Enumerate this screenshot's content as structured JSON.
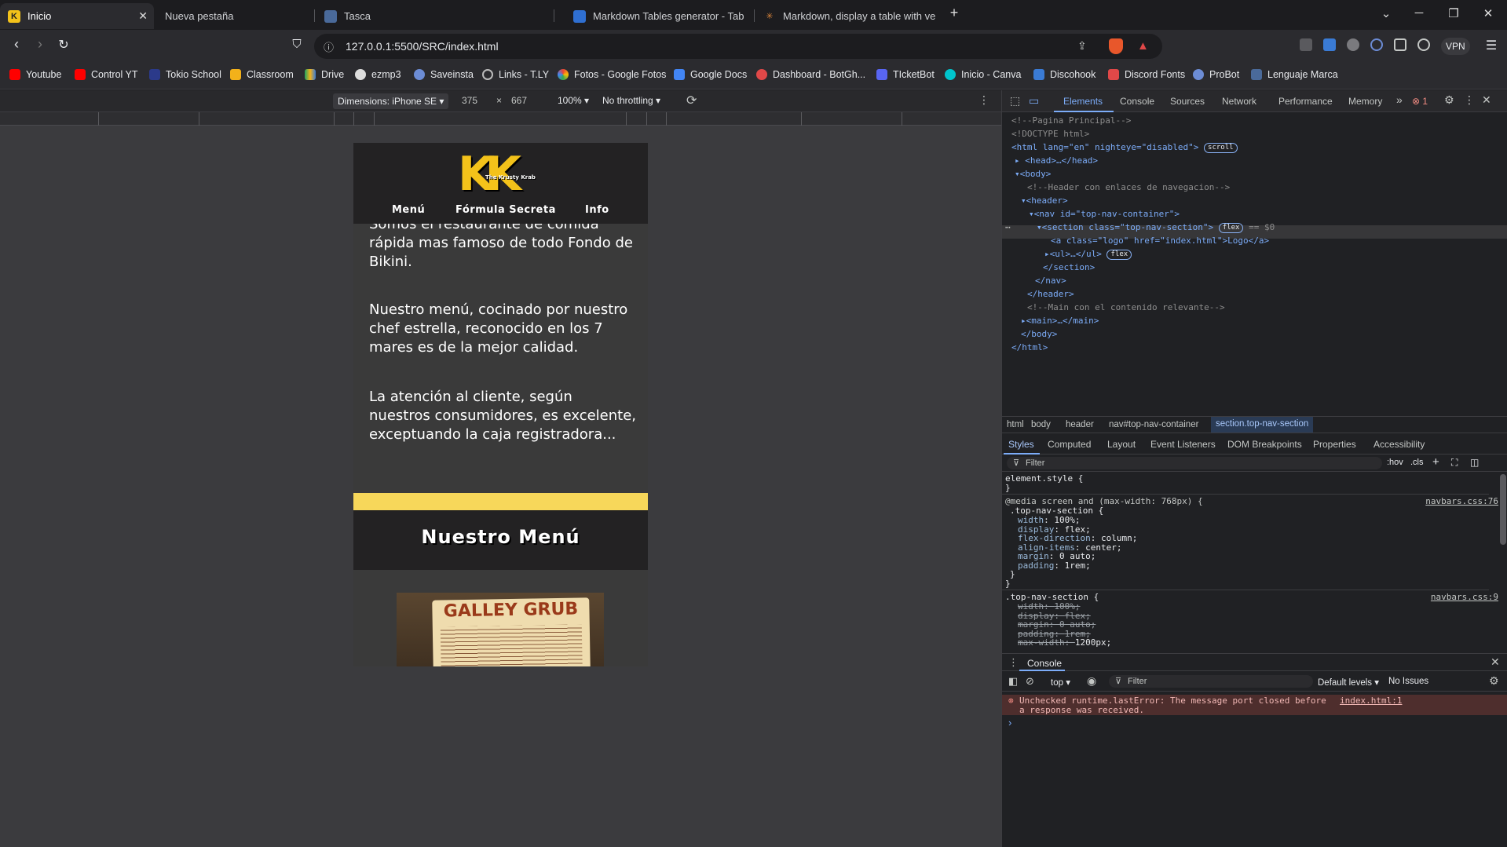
{
  "browser": {
    "tabs": [
      {
        "title": "Inicio",
        "favicon": "K",
        "active": true
      },
      {
        "title": "Nueva pestaña"
      },
      {
        "title": "Tasca"
      },
      {
        "title": "Markdown Tables generator - Tables"
      },
      {
        "title": "Markdown, display a table with vert"
      }
    ],
    "new_tab": "+",
    "url": "127.0.0.1:5500/SRC/index.html",
    "vpn_label": "VPN",
    "bookmarks": [
      "Youtube",
      "Control YT",
      "Tokio School",
      "Classroom",
      "Drive",
      "ezmp3",
      "Saveinsta",
      "Links - T.LY",
      "Fotos - Google Fotos",
      "Google Docs",
      "Dashboard - BotGh...",
      "TIcketBot",
      "Inicio - Canva",
      "Discohook",
      "Discord Fonts",
      "ProBot",
      "Lenguaje Marca"
    ]
  },
  "device_toolbar": {
    "dimensions": "Dimensions: iPhone SE",
    "width": "375",
    "times": "×",
    "height": "667",
    "zoom": "100%",
    "throttling": "No throttling"
  },
  "site": {
    "logo_text": "KK",
    "logo_sub": "The Krusty Krab",
    "nav": [
      "Menú",
      "Fórmula Secreta",
      "Info"
    ],
    "paragraph_1": "Somos el restaurante de comida rápida mas famoso de todo Fondo de Bikini.",
    "paragraph_2": "Nuestro menú, cocinado por nuestro chef estrella, reconocido en los 7 mares es de la mejor calidad.",
    "paragraph_3": "La atención al cliente, según nuestros consumidores, es excelente, exceptuando la caja registradora...",
    "menu_heading": "Nuestro Menú",
    "menu_image_title": "GALLEY GRUB"
  },
  "devtools": {
    "tabs": [
      "Elements",
      "Console",
      "Sources",
      "Network",
      "Performance",
      "Memory"
    ],
    "more": "»",
    "error_count": "1",
    "dom": [
      "<!--Pagina Principal-->",
      "<!DOCTYPE html>",
      "<html lang=\"en\" nighteye=\"disabled\">",
      "<head>…</head>",
      "<body>",
      "<!--Header con enlaces de navegacion-->",
      "<header>",
      "<nav id=\"top-nav-container\">",
      "<section class=\"top-nav-section\">",
      "<a class=\"logo\" href=\"index.html\">Logo</a>",
      "<ul>…</ul>",
      "</section>",
      "</nav>",
      "</header>",
      "<!--Main con el contenido relevante-->",
      "<main>…</main>",
      "</body>",
      "</html>"
    ],
    "pill_scroll": "scroll",
    "pill_flex": "flex",
    "selected_suffix": "== $0",
    "breadcrumbs": [
      "html",
      "body",
      "header",
      "nav#top-nav-container",
      "section.top-nav-section"
    ],
    "style_tabs": [
      "Styles",
      "Computed",
      "Layout",
      "Event Listeners",
      "DOM Breakpoints",
      "Properties",
      "Accessibility"
    ],
    "filter_placeholder": "Filter",
    "hov": ":hov",
    "cls": ".cls",
    "styles": {
      "element_style": "element.style {",
      "close_brace": "}",
      "media": "@media screen and (max-width: 768px) {",
      "selector": ".top-nav-section {",
      "src1": "navbars.css:76",
      "src2": "navbars.css:9",
      "rules1": [
        [
          "width",
          "100%;"
        ],
        [
          "display",
          "flex;"
        ],
        [
          "flex-direction",
          "column;"
        ],
        [
          "align-items",
          "center;"
        ],
        [
          "margin",
          "0 auto;"
        ],
        [
          "padding",
          "1rem;"
        ]
      ],
      "rules2": [
        [
          "width",
          "100%;"
        ],
        [
          "display",
          "flex;"
        ],
        [
          "margin",
          "0 auto;"
        ],
        [
          "padding",
          "1rem;"
        ],
        [
          "max-width",
          "1200px;"
        ]
      ]
    },
    "console": {
      "title": "Console",
      "context": "top",
      "filter": "Filter",
      "levels": "Default levels",
      "issues": "No Issues",
      "error": "Unchecked runtime.lastError: The message port closed before a response was received.",
      "error_src": "index.html:1",
      "prompt": "›"
    }
  },
  "colors": {
    "accent": "#7cacf8",
    "logo_yellow": "#f3c21a",
    "band_yellow": "#f7d75a",
    "error_bg": "#4e2e2d"
  }
}
